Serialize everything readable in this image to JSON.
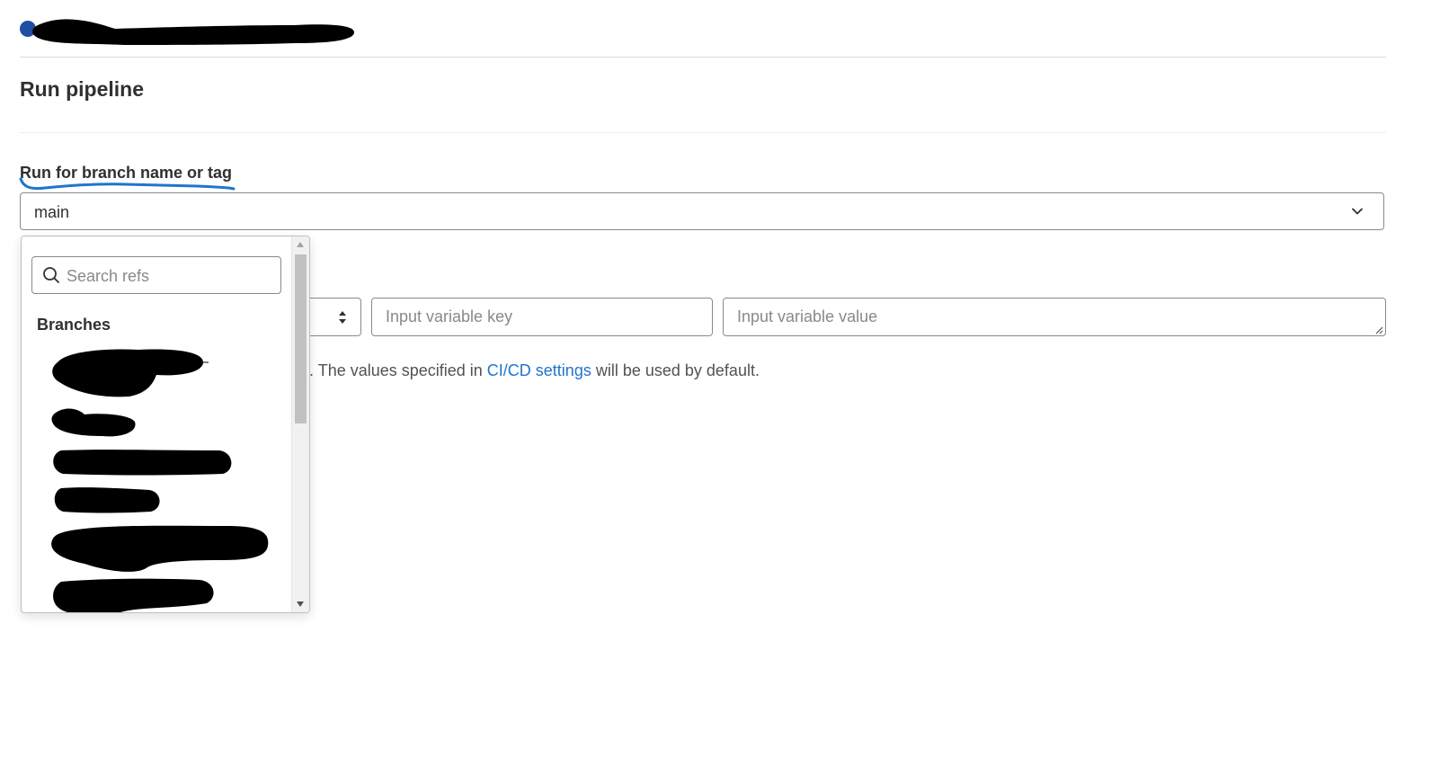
{
  "header": {
    "breadcrumb_redacted": true
  },
  "page": {
    "title": "Run pipeline"
  },
  "ref_field": {
    "label": "Run for branch name or tag",
    "selected_value": "main",
    "annotation_underline_color": "#1f75cb"
  },
  "ref_dropdown": {
    "search_placeholder": "Search refs",
    "section_title": "Branches",
    "branches_redacted_count": 6
  },
  "variables": {
    "key_placeholder": "Input variable key",
    "value_placeholder": "Input variable value"
  },
  "help": {
    "text_before_link": "is run. The values specified in ",
    "link_text": "CI/CD settings",
    "text_after_link": " will be used by default."
  },
  "colors": {
    "link": "#1f75cb",
    "border": "#89888d",
    "text": "#303030",
    "redaction": "#000000"
  }
}
